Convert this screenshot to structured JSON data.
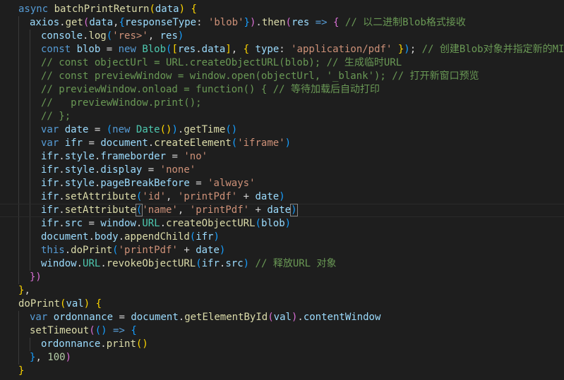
{
  "editor": {
    "lines": [
      {
        "indent": 1,
        "tokens": [
          [
            "kw",
            "async "
          ],
          [
            "fn",
            "batchPrintReturn"
          ],
          [
            "br1",
            "("
          ],
          [
            "var",
            "data"
          ],
          [
            "br1",
            ")"
          ],
          [
            "txt",
            " "
          ],
          [
            "br1",
            "{"
          ]
        ]
      },
      {
        "indent": 2,
        "tokens": [
          [
            "var",
            "axios"
          ],
          [
            "txt",
            "."
          ],
          [
            "fn",
            "get"
          ],
          [
            "br2",
            "("
          ],
          [
            "var",
            "data"
          ],
          [
            "txt",
            ","
          ],
          [
            "br3",
            "{"
          ],
          [
            "var",
            "responseType"
          ],
          [
            "txt",
            ": "
          ],
          [
            "str",
            "'blob'"
          ],
          [
            "br3",
            "}"
          ],
          [
            "br2",
            ")"
          ],
          [
            "txt",
            "."
          ],
          [
            "fn",
            "then"
          ],
          [
            "br2",
            "("
          ],
          [
            "var",
            "res"
          ],
          [
            "txt",
            " "
          ],
          [
            "kw",
            "=>"
          ],
          [
            "txt",
            " "
          ],
          [
            "br2",
            "{"
          ],
          [
            "txt",
            " "
          ],
          [
            "cmt",
            "// 以二进制Blob格式接收"
          ]
        ]
      },
      {
        "indent": 3,
        "tokens": [
          [
            "var",
            "console"
          ],
          [
            "txt",
            "."
          ],
          [
            "fn",
            "log"
          ],
          [
            "br3",
            "("
          ],
          [
            "str",
            "'res>'"
          ],
          [
            "txt",
            ", "
          ],
          [
            "var",
            "res"
          ],
          [
            "br3",
            ")"
          ]
        ]
      },
      {
        "indent": 3,
        "tokens": [
          [
            "kw",
            "const "
          ],
          [
            "var",
            "blob"
          ],
          [
            "txt",
            " = "
          ],
          [
            "kw",
            "new "
          ],
          [
            "cls",
            "Blob"
          ],
          [
            "br3",
            "("
          ],
          [
            "br1",
            "["
          ],
          [
            "var",
            "res"
          ],
          [
            "txt",
            "."
          ],
          [
            "var",
            "data"
          ],
          [
            "br1",
            "]"
          ],
          [
            "txt",
            ", "
          ],
          [
            "br1",
            "{"
          ],
          [
            "txt",
            " "
          ],
          [
            "var",
            "type"
          ],
          [
            "txt",
            ": "
          ],
          [
            "str",
            "'application/pdf'"
          ],
          [
            "txt",
            " "
          ],
          [
            "br1",
            "}"
          ],
          [
            "br3",
            ")"
          ],
          [
            "txt",
            "; "
          ],
          [
            "cmt",
            "// 创建Blob对象并指定新的MIME类"
          ]
        ]
      },
      {
        "indent": 3,
        "tokens": [
          [
            "cmt",
            "// const objectUrl = URL.createObjectURL(blob); // 生成临时URL"
          ]
        ]
      },
      {
        "indent": 3,
        "tokens": [
          [
            "cmt",
            "// const previewWindow = window.open(objectUrl, '_blank'); // 打开新窗口预览"
          ]
        ]
      },
      {
        "indent": 3,
        "tokens": [
          [
            "cmt",
            "// previewWindow.onload = function() { // 等待加载后自动打印"
          ]
        ]
      },
      {
        "indent": 3,
        "tokens": [
          [
            "cmt",
            "//   previewWindow.print();"
          ]
        ]
      },
      {
        "indent": 3,
        "tokens": [
          [
            "cmt",
            "// };"
          ]
        ]
      },
      {
        "indent": 3,
        "tokens": [
          [
            "kw",
            "var "
          ],
          [
            "var",
            "date"
          ],
          [
            "txt",
            " = "
          ],
          [
            "br3",
            "("
          ],
          [
            "kw",
            "new "
          ],
          [
            "cls",
            "Date"
          ],
          [
            "br1",
            "()"
          ],
          [
            "br3",
            ")"
          ],
          [
            "txt",
            "."
          ],
          [
            "fn",
            "getTime"
          ],
          [
            "br3",
            "()"
          ]
        ]
      },
      {
        "indent": 3,
        "tokens": [
          [
            "kw",
            "var "
          ],
          [
            "var",
            "ifr"
          ],
          [
            "txt",
            " = "
          ],
          [
            "var",
            "document"
          ],
          [
            "txt",
            "."
          ],
          [
            "fn",
            "createElement"
          ],
          [
            "br3",
            "("
          ],
          [
            "str",
            "'iframe'"
          ],
          [
            "br3",
            ")"
          ]
        ]
      },
      {
        "indent": 3,
        "tokens": [
          [
            "var",
            "ifr"
          ],
          [
            "txt",
            "."
          ],
          [
            "var",
            "style"
          ],
          [
            "txt",
            "."
          ],
          [
            "var",
            "frameborder"
          ],
          [
            "txt",
            " = "
          ],
          [
            "str",
            "'no'"
          ]
        ]
      },
      {
        "indent": 3,
        "tokens": [
          [
            "var",
            "ifr"
          ],
          [
            "txt",
            "."
          ],
          [
            "var",
            "style"
          ],
          [
            "txt",
            "."
          ],
          [
            "var",
            "display"
          ],
          [
            "txt",
            " = "
          ],
          [
            "str",
            "'none'"
          ]
        ]
      },
      {
        "indent": 3,
        "tokens": [
          [
            "var",
            "ifr"
          ],
          [
            "txt",
            "."
          ],
          [
            "var",
            "style"
          ],
          [
            "txt",
            "."
          ],
          [
            "var",
            "pageBreakBefore"
          ],
          [
            "txt",
            " = "
          ],
          [
            "str",
            "'always'"
          ]
        ]
      },
      {
        "indent": 3,
        "tokens": [
          [
            "var",
            "ifr"
          ],
          [
            "txt",
            "."
          ],
          [
            "fn",
            "setAttribute"
          ],
          [
            "br3",
            "("
          ],
          [
            "str",
            "'id'"
          ],
          [
            "txt",
            ", "
          ],
          [
            "str",
            "'printPdf'"
          ],
          [
            "txt",
            " + "
          ],
          [
            "var",
            "date"
          ],
          [
            "br3",
            ")"
          ]
        ]
      },
      {
        "indent": 3,
        "active": true,
        "tokens": [
          [
            "var",
            "ifr"
          ],
          [
            "txt",
            "."
          ],
          [
            "fn",
            "setAttribute"
          ],
          [
            "br3bm",
            "("
          ],
          [
            "str",
            "'name'"
          ],
          [
            "txt",
            ", "
          ],
          [
            "str",
            "'printPdf'"
          ],
          [
            "txt",
            " + "
          ],
          [
            "var",
            "date"
          ],
          [
            "br3bm",
            ")"
          ]
        ]
      },
      {
        "indent": 3,
        "tokens": [
          [
            "var",
            "ifr"
          ],
          [
            "txt",
            "."
          ],
          [
            "var",
            "src"
          ],
          [
            "txt",
            " = "
          ],
          [
            "var",
            "window"
          ],
          [
            "txt",
            "."
          ],
          [
            "cls",
            "URL"
          ],
          [
            "txt",
            "."
          ],
          [
            "fn",
            "createObjectURL"
          ],
          [
            "br3",
            "("
          ],
          [
            "var",
            "blob"
          ],
          [
            "br3",
            ")"
          ]
        ]
      },
      {
        "indent": 3,
        "tokens": [
          [
            "var",
            "document"
          ],
          [
            "txt",
            "."
          ],
          [
            "var",
            "body"
          ],
          [
            "txt",
            "."
          ],
          [
            "fn",
            "appendChild"
          ],
          [
            "br3",
            "("
          ],
          [
            "var",
            "ifr"
          ],
          [
            "br3",
            ")"
          ]
        ]
      },
      {
        "indent": 3,
        "tokens": [
          [
            "kw",
            "this"
          ],
          [
            "txt",
            "."
          ],
          [
            "fn",
            "doPrint"
          ],
          [
            "br3",
            "("
          ],
          [
            "str",
            "'printPdf'"
          ],
          [
            "txt",
            " + "
          ],
          [
            "var",
            "date"
          ],
          [
            "br3",
            ")"
          ]
        ]
      },
      {
        "indent": 3,
        "tokens": [
          [
            "var",
            "window"
          ],
          [
            "txt",
            "."
          ],
          [
            "cls",
            "URL"
          ],
          [
            "txt",
            "."
          ],
          [
            "fn",
            "revokeObjectURL"
          ],
          [
            "br3",
            "("
          ],
          [
            "var",
            "ifr"
          ],
          [
            "txt",
            "."
          ],
          [
            "var",
            "src"
          ],
          [
            "br3",
            ")"
          ],
          [
            "txt",
            " "
          ],
          [
            "cmt",
            "// 释放URL 对象"
          ]
        ]
      },
      {
        "indent": 2,
        "tokens": [
          [
            "br2",
            "})"
          ]
        ]
      },
      {
        "indent": 1,
        "tokens": [
          [
            "br1",
            "}"
          ],
          [
            "txt",
            ","
          ]
        ]
      },
      {
        "indent": 1,
        "tokens": [
          [
            "fn",
            "doPrint"
          ],
          [
            "br1",
            "("
          ],
          [
            "var",
            "val"
          ],
          [
            "br1",
            ")"
          ],
          [
            "txt",
            " "
          ],
          [
            "br1",
            "{"
          ]
        ]
      },
      {
        "indent": 2,
        "tokens": [
          [
            "kw",
            "var "
          ],
          [
            "var",
            "ordonnance"
          ],
          [
            "txt",
            " = "
          ],
          [
            "var",
            "document"
          ],
          [
            "txt",
            "."
          ],
          [
            "fn",
            "getElementById"
          ],
          [
            "br2",
            "("
          ],
          [
            "var",
            "val"
          ],
          [
            "br2",
            ")"
          ],
          [
            "txt",
            "."
          ],
          [
            "var",
            "contentWindow"
          ]
        ]
      },
      {
        "indent": 2,
        "tokens": [
          [
            "fn",
            "setTimeout"
          ],
          [
            "br2",
            "("
          ],
          [
            "br3",
            "()"
          ],
          [
            "txt",
            " "
          ],
          [
            "kw",
            "=>"
          ],
          [
            "txt",
            " "
          ],
          [
            "br3",
            "{"
          ]
        ]
      },
      {
        "indent": 3,
        "tokens": [
          [
            "var",
            "ordonnance"
          ],
          [
            "txt",
            "."
          ],
          [
            "fn",
            "print"
          ],
          [
            "br1",
            "()"
          ]
        ]
      },
      {
        "indent": 2,
        "tokens": [
          [
            "br3",
            "}"
          ],
          [
            "txt",
            ", "
          ],
          [
            "num",
            "100"
          ],
          [
            "br2",
            ")"
          ]
        ]
      },
      {
        "indent": 1,
        "tokens": [
          [
            "br1",
            "}"
          ]
        ]
      },
      {
        "indent": 0,
        "tokens": [
          [
            "txt",
            ","
          ]
        ]
      }
    ]
  }
}
